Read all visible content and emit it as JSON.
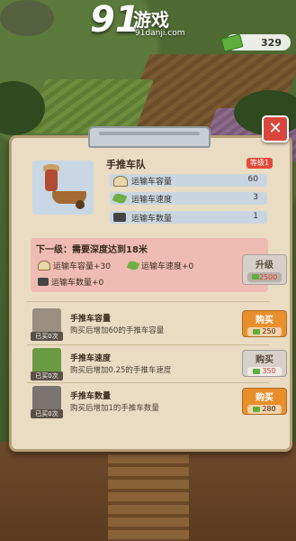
{
  "top": {
    "logo_main": "91",
    "logo_cn": "游戏",
    "logo_url": "91danji.com",
    "money": "329"
  },
  "panel": {
    "title": "手推车队",
    "level": "等级1",
    "close": "✕",
    "stats": [
      {
        "icon": "ore-pile-icon",
        "label": "运输车容量",
        "value": "60"
      },
      {
        "icon": "leaf-speed-icon",
        "label": "运输车速度",
        "value": "3"
      },
      {
        "icon": "cart-icon",
        "label": "运输车数量",
        "value": "1"
      }
    ],
    "next": {
      "title": "下一级：需要深度达到18米",
      "bonus1": "运输车容量+30",
      "bonus2": "运输车速度+0",
      "bonus3": "运输车数量+0",
      "upgrade_label": "升级",
      "upgrade_cost": "2500"
    },
    "items": [
      {
        "title": "手推车容量",
        "desc": "购买后增加60的手推车容量",
        "bought": "已买0次",
        "buy_label": "购买",
        "cost": "250"
      },
      {
        "title": "手推车速度",
        "desc": "购买后增加0.25的手推车速度",
        "bought": "已买0次",
        "buy_label": "购买",
        "cost": "350"
      },
      {
        "title": "手推车数量",
        "desc": "购买后增加1的手推车数量",
        "bought": "已买0次",
        "buy_label": "购买",
        "cost": "280"
      }
    ]
  }
}
